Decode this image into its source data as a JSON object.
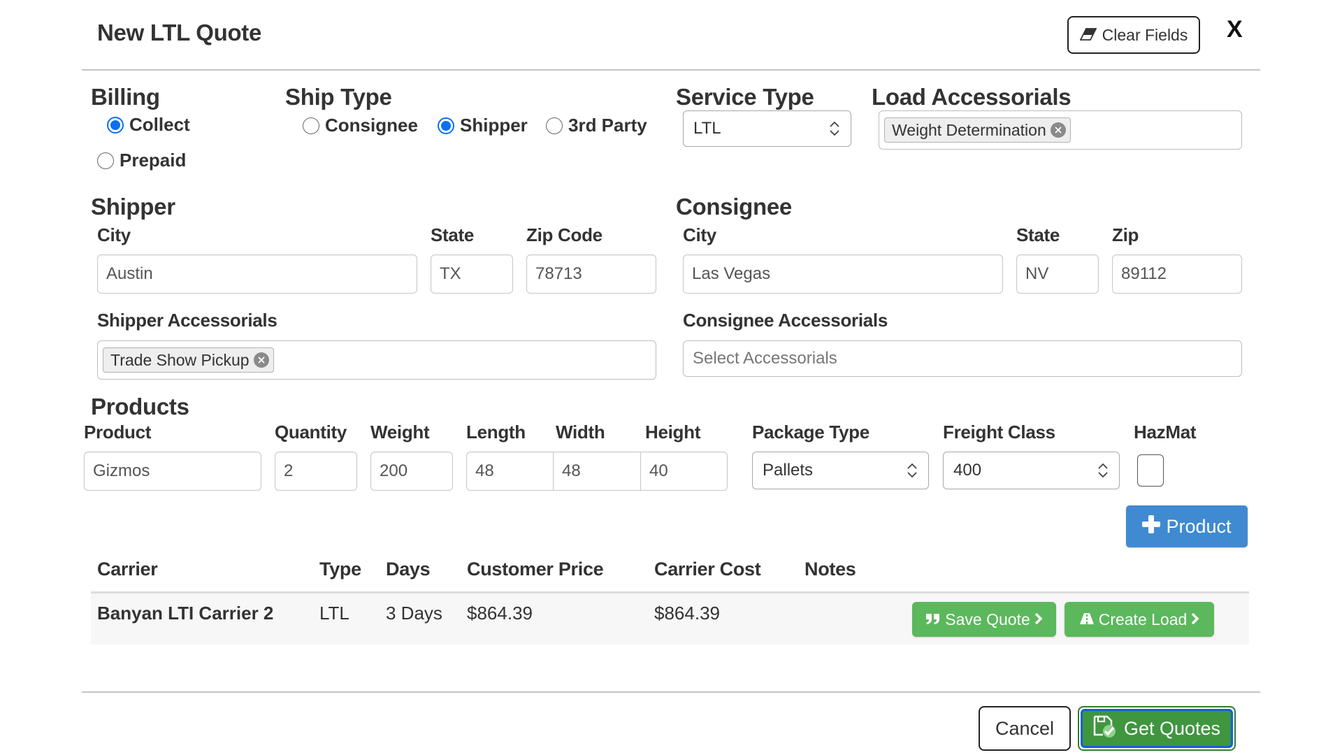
{
  "dialog": {
    "title": "New LTL Quote",
    "clear_fields_label": "Clear Fields",
    "clear_fields_icon": "eraser-icon",
    "close_label": "X"
  },
  "billing": {
    "heading": "Billing",
    "options": [
      {
        "label": "Collect",
        "checked": true
      },
      {
        "label": "Prepaid",
        "checked": false
      }
    ]
  },
  "ship_type": {
    "heading": "Ship Type",
    "options": [
      {
        "label": "Consignee",
        "checked": false
      },
      {
        "label": "Shipper",
        "checked": true
      },
      {
        "label": "3rd Party",
        "checked": false
      }
    ]
  },
  "service_type": {
    "heading": "Service Type",
    "value": "LTL"
  },
  "load_accessorials": {
    "heading": "Load Accessorials",
    "tags": [
      "Weight Determination"
    ]
  },
  "shipper": {
    "heading": "Shipper",
    "city_label": "City",
    "city": "Austin",
    "state_label": "State",
    "state": "TX",
    "zip_label": "Zip Code",
    "zip": "78713",
    "accessorials_label": "Shipper Accessorials",
    "accessorials_tags": [
      "Trade Show Pickup"
    ]
  },
  "consignee": {
    "heading": "Consignee",
    "city_label": "City",
    "city": "Las Vegas",
    "state_label": "State",
    "state": "NV",
    "zip_label": "Zip",
    "zip": "89112",
    "accessorials_label": "Consignee Accessorials",
    "accessorials_placeholder": "Select Accessorials"
  },
  "products": {
    "heading": "Products",
    "columns": {
      "product": "Product",
      "quantity": "Quantity",
      "weight": "Weight",
      "length": "Length",
      "width": "Width",
      "height": "Height",
      "package_type": "Package Type",
      "freight_class": "Freight Class",
      "hazmat": "HazMat"
    },
    "row": {
      "product": "Gizmos",
      "quantity": "2",
      "weight": "200",
      "length": "48",
      "width": "48",
      "height": "40",
      "package_type": "Pallets",
      "freight_class": "400",
      "hazmat": false
    },
    "add_product_label": "Product"
  },
  "results": {
    "columns": [
      "Carrier",
      "Type",
      "Days",
      "Customer Price",
      "Carrier Cost",
      "Notes"
    ],
    "rows": [
      {
        "carrier": "Banyan LTI Carrier 2",
        "type": "LTL",
        "days": "3 Days",
        "customer_price": "$864.39",
        "carrier_cost": "$864.39",
        "notes": "",
        "save_quote_label": "Save Quote",
        "create_load_label": "Create Load"
      }
    ]
  },
  "footer": {
    "cancel_label": "Cancel",
    "get_quotes_label": "Get Quotes"
  },
  "colors": {
    "radio_accent": "#0a6ff0",
    "primary_blue": "#3f8ad0",
    "success_green": "#5cb85c",
    "get_quotes_green": "#3f963f",
    "focus_ring": "#1560d8"
  }
}
